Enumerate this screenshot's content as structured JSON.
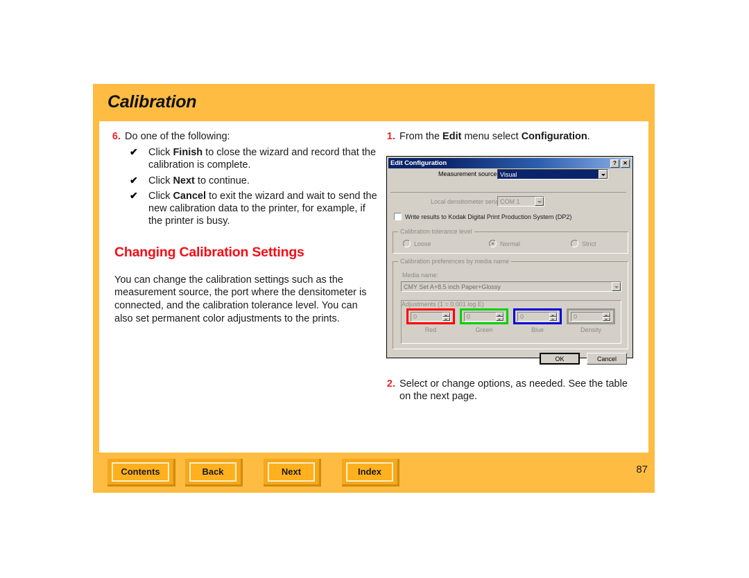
{
  "page": {
    "title": "Calibration",
    "number": "87",
    "accent_orange": "#ffbc42",
    "heading_red": "#f50d16",
    "step_number_red": "#e8252a"
  },
  "left_column": {
    "step": {
      "number": "6.",
      "text": "Do one of the following:"
    },
    "bullets": [
      {
        "mark": "✔",
        "text": "Click Finish to close the wizard and record that the calibration is complete.",
        "bold_words": [
          "Finish"
        ]
      },
      {
        "mark": "✔",
        "text": "Click Next to continue.",
        "bold_words": [
          "Next"
        ]
      },
      {
        "mark": "✔",
        "text": "Click Cancel to exit the wizard and wait to send the new calibration data to the printer, for example, if the printer is busy.",
        "bold_words": [
          "Cancel"
        ]
      }
    ],
    "section_heading": "Changing Calibration Settings",
    "body_paragraph": "You can change the calibration settings such as the measurement source, the port where the densitometer is connected, and the calibration tolerance level. You can also set permanent color adjustments to the prints."
  },
  "right_column": {
    "step_1": {
      "number": "1.",
      "text_parts": [
        "From the ",
        "Edit",
        " menu select ",
        "Configuration",
        "."
      ]
    },
    "step_2": {
      "number": "2.",
      "text": "Select or change options, as needed. See the table on the next page."
    }
  },
  "dialog": {
    "title": "Edit Configuration",
    "titlebar_buttons": [
      {
        "name": "help",
        "glyph": "?"
      },
      {
        "name": "close",
        "glyph": "✕"
      }
    ],
    "measurement_source": {
      "label": "Measurement source:",
      "value": "Visual",
      "selected": true
    },
    "serial_port": {
      "label": "Local densitometer serial port:",
      "value": "COM 1",
      "disabled": true
    },
    "dp2_checkbox": {
      "label": "Write results to Kodak Digital Print Production System (DP2)",
      "checked": false
    },
    "tolerance_group": {
      "title": "Calibration tolerance level",
      "options": [
        {
          "label": "Loose",
          "checked": false
        },
        {
          "label": "Normal",
          "checked": true
        },
        {
          "label": "Strict",
          "checked": false
        }
      ]
    },
    "media_group": {
      "title": "Calibration preferences by media name",
      "media_name_label": "Media name:",
      "media_name_value": "CMY Set A+8.5 inch Paper+Glossy"
    },
    "adjustments_group": {
      "title": "Adjustments (1 = 0.001 log E)",
      "fields": [
        {
          "label": "Red",
          "value": "0",
          "outline_color": "#ff0000"
        },
        {
          "label": "Green",
          "value": "0",
          "outline_color": "#00d000"
        },
        {
          "label": "Blue",
          "value": "0",
          "outline_color": "#0000d8"
        },
        {
          "label": "Density",
          "value": "0",
          "outline_color": "#999990"
        }
      ]
    },
    "buttons": {
      "ok": "OK",
      "cancel": "Cancel"
    }
  },
  "footer": {
    "nav": [
      {
        "label": "Contents"
      },
      {
        "label": "Back"
      },
      {
        "label": "Next"
      },
      {
        "label": "Index"
      }
    ]
  }
}
